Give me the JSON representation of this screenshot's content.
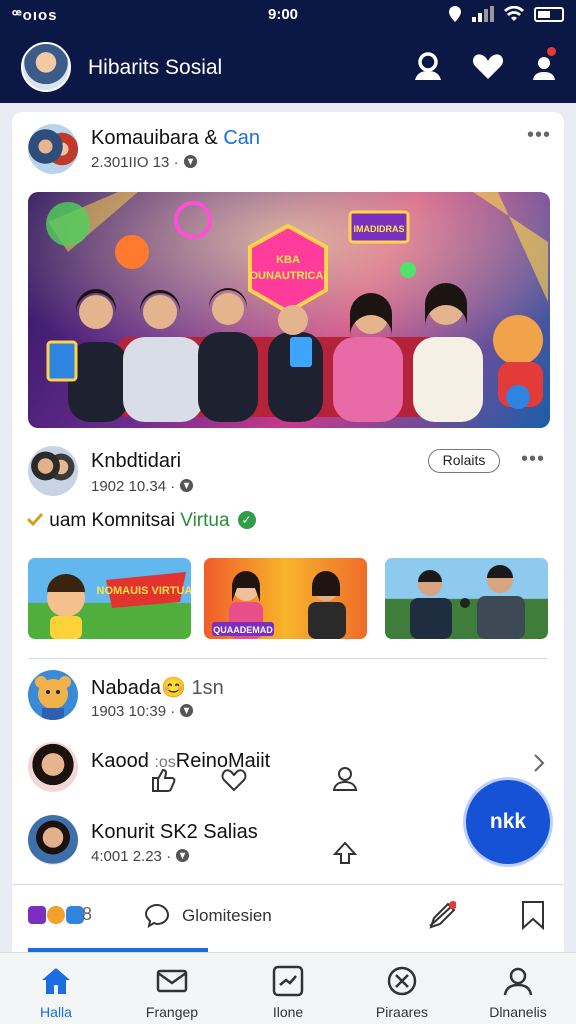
{
  "status_bar": {
    "left": "ꟹoıos",
    "time": "9:00"
  },
  "header": {
    "title": "Hibarits Sosial"
  },
  "posts": [
    {
      "name_a": "Komauibara &",
      "name_b": "Can",
      "meta": "2.301ΙΙΟ 13",
      "dot": "·"
    },
    {
      "name": "Knbdtidari",
      "meta": "1902 10.34",
      "dot": "·",
      "pill": "Rolaits",
      "subline_a": "uam Komnitsai",
      "subline_b": "Virtua"
    },
    {
      "name": "Nabada",
      "emoji": "😊",
      "suffix": "1sn",
      "meta": "1903 10:39",
      "dot": "·"
    },
    {
      "name": "Kaood",
      "mid": ":os",
      "tail": "ReinoMaiit"
    },
    {
      "name": "Konurit SK2 Salias",
      "meta": "4:001 2.23",
      "dot": "·"
    }
  ],
  "hero_banner": {
    "line1": "KBA",
    "line2": "OUNAUTRICAI",
    "sign": "IMADIDRAS"
  },
  "thumbs": [
    {
      "banner": "NOMAUIS VIRTUAI"
    },
    {
      "banner": "QUAADEMAD"
    },
    {
      "banner": ""
    }
  ],
  "fab": {
    "label": "nkk"
  },
  "comment_bar": {
    "label": "Glomitesien",
    "badge": "8"
  },
  "nav": [
    {
      "label": "Halla",
      "icon": "home-icon"
    },
    {
      "label": "Frangep",
      "icon": "mail-icon"
    },
    {
      "label": "Ilone",
      "icon": "chart-icon"
    },
    {
      "label": "Piraares",
      "icon": "explore-icon"
    },
    {
      "label": "Dlnanelis",
      "icon": "profile-icon"
    }
  ],
  "colors": {
    "header_bg": "#0b1846",
    "accent": "#1a6fe0",
    "fab": "#1552d6",
    "verified": "#2e9e48"
  }
}
